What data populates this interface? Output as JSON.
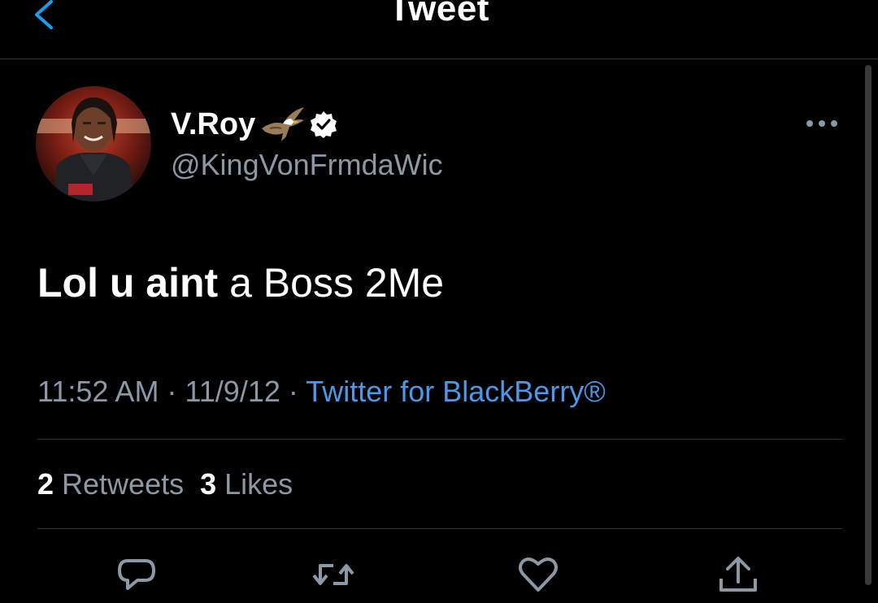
{
  "nav": {
    "title": "Tweet",
    "back_icon": "chevron-left-icon",
    "accent_color": "#1d9bf0"
  },
  "author": {
    "display_name": "V.Roy",
    "name_emoji_icon": "eagle-icon",
    "verified_icon": "verified-badge-icon",
    "handle": "@KingVonFrmdaWic"
  },
  "tweet": {
    "text_bold": "Lol u aint",
    "text_regular": " a Boss 2Me",
    "time": "11:52 AM",
    "separator": " · ",
    "date": "11/9/12",
    "source": "Twitter for BlackBerry®"
  },
  "stats": {
    "retweets_count": "2",
    "retweets_label": " Retweets",
    "likes_count": "3",
    "likes_label": " Likes"
  },
  "actions": {
    "reply_icon": "reply-icon",
    "retweet_icon": "retweet-icon",
    "like_icon": "heart-icon",
    "share_icon": "share-icon"
  },
  "colors": {
    "background": "#000000",
    "secondary_text": "#8b98a5",
    "link": "#4a99e9",
    "divider": "#2f3336"
  }
}
